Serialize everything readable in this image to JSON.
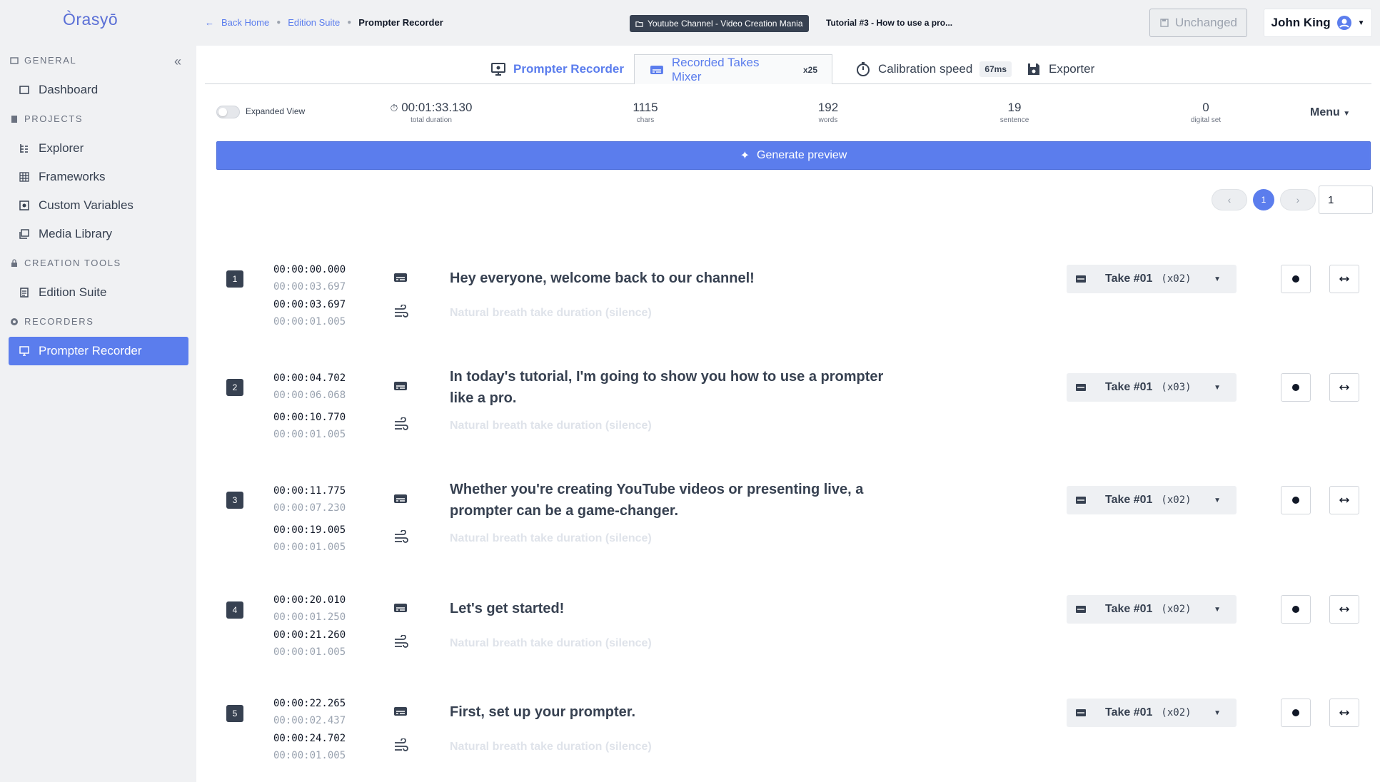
{
  "brand": {
    "logo": "Òrasyō"
  },
  "sidebar": {
    "sections": [
      {
        "label": "GENERAL"
      },
      {
        "label": "PROJECTS"
      },
      {
        "label": "CREATION TOOLS"
      },
      {
        "label": "RECORDERS"
      }
    ],
    "items": [
      {
        "label": "Dashboard",
        "icon": "dashboard-icon"
      },
      {
        "label": "Explorer",
        "icon": "explorer-icon"
      },
      {
        "label": "Frameworks",
        "icon": "grid-icon"
      },
      {
        "label": "Custom Variables",
        "icon": "variable-icon"
      },
      {
        "label": "Media Library",
        "icon": "media-icon"
      },
      {
        "label": "Edition Suite",
        "icon": "document-icon"
      },
      {
        "label": "Prompter Recorder",
        "icon": "monitor-icon",
        "active": true
      }
    ]
  },
  "header": {
    "breadcrumb": [
      "Back Home",
      "Edition Suite",
      "Prompter Recorder"
    ],
    "channel": "Youtube Channel - Video Creation Mania",
    "tutorial": "Tutorial #3 - How to use a pro...",
    "unchanged": "Unchanged",
    "user": "John King"
  },
  "tabs": [
    {
      "label": "Prompter Recorder",
      "icon": "monitor-icon"
    },
    {
      "label": "Recorded Takes Mixer",
      "count": "x25",
      "icon": "takes-icon"
    },
    {
      "label": "Calibration speed",
      "badge": "67ms",
      "icon": "stopwatch-icon"
    },
    {
      "label": "Exporter",
      "icon": "save-icon"
    }
  ],
  "stats": {
    "expanded_view": "Expanded View",
    "duration": {
      "value": "00:01:33.130",
      "label": "total duration"
    },
    "chars": {
      "value": "1115",
      "label": "chars"
    },
    "words": {
      "value": "192",
      "label": "words"
    },
    "sentence": {
      "value": "19",
      "label": "sentence"
    },
    "digital": {
      "value": "0",
      "label": "digital set"
    },
    "menu": "Menu"
  },
  "generate_label": "Generate preview",
  "pagination": {
    "current": "1",
    "input": "1"
  },
  "rows": [
    {
      "num": "1",
      "start": "00:00:00.000",
      "dur": "00:00:03.697",
      "pstart": "00:00:03.697",
      "pdur": "00:00:01.005",
      "line1": "Hey everyone, welcome back to our channel!",
      "line2": "",
      "silence": "Natural breath take duration (silence)",
      "take": "Take #01",
      "take_count": "(x02)"
    },
    {
      "num": "2",
      "start": "00:00:04.702",
      "dur": "00:00:06.068",
      "pstart": "00:00:10.770",
      "pdur": "00:00:01.005",
      "line1": "In today's tutorial, I'm going to show you how to use a prompter",
      "line2": "like a pro.",
      "silence": "Natural breath take duration (silence)",
      "take": "Take #01",
      "take_count": "(x03)"
    },
    {
      "num": "3",
      "start": "00:00:11.775",
      "dur": "00:00:07.230",
      "pstart": "00:00:19.005",
      "pdur": "00:00:01.005",
      "line1": "Whether you're creating YouTube videos or presenting live, a",
      "line2": "prompter can be a game-changer.",
      "silence": "Natural breath take duration (silence)",
      "take": "Take #01",
      "take_count": "(x02)"
    },
    {
      "num": "4",
      "start": "00:00:20.010",
      "dur": "00:00:01.250",
      "pstart": "00:00:21.260",
      "pdur": "00:00:01.005",
      "line1": "Let's get started!",
      "line2": "",
      "silence": "Natural breath take duration (silence)",
      "take": "Take #01",
      "take_count": "(x02)"
    },
    {
      "num": "5",
      "start": "00:00:22.265",
      "dur": "00:00:02.437",
      "pstart": "00:00:24.702",
      "pdur": "00:00:01.005",
      "line1": "First, set up your prompter.",
      "line2": "",
      "silence": "Natural breath take duration (silence)",
      "take": "Take #01",
      "take_count": "(x02)"
    }
  ]
}
